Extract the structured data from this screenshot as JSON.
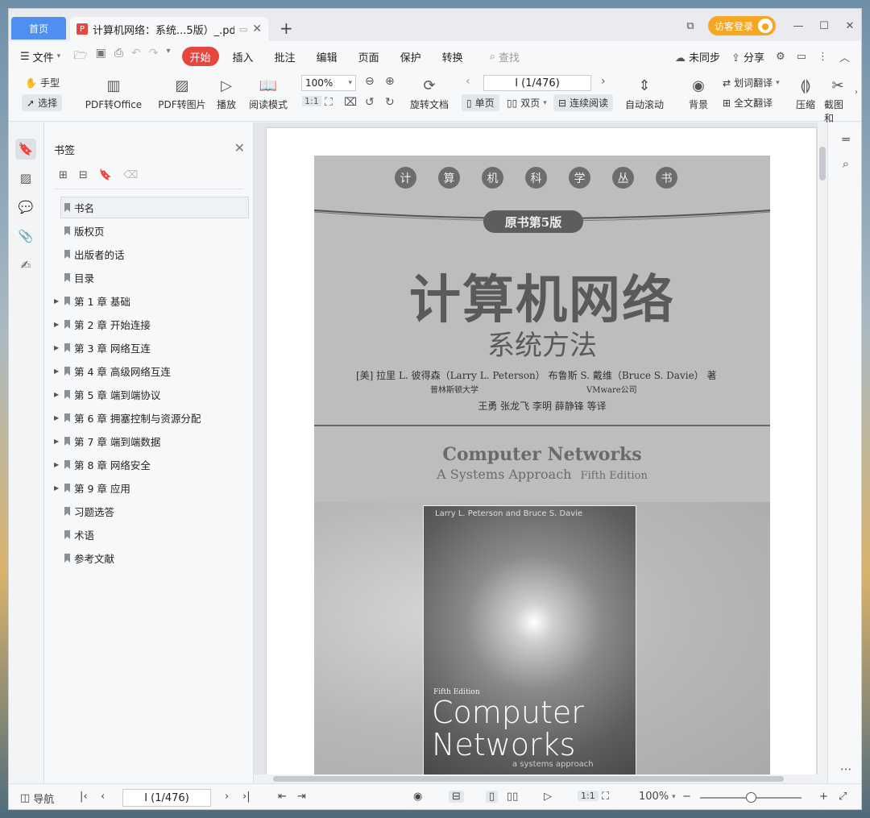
{
  "titlebar": {
    "home_tab": "首页",
    "doc_tab_title": "计算机网络：系统...5版）_.pdf",
    "pdf_badge": "P",
    "add_tab": "+",
    "login_button": "访客登录",
    "minimize": "—",
    "maximize": "☐",
    "close": "✕"
  },
  "menubar": {
    "file": "文件",
    "tabs": [
      "开始",
      "插入",
      "批注",
      "编辑",
      "页面",
      "保护",
      "转换"
    ],
    "search": "查找",
    "sync": "未同步",
    "share": "分享"
  },
  "ribbon": {
    "hand": "手型",
    "select": "选择",
    "pdf_to_office": "PDF转Office",
    "pdf_to_image": "PDF转图片",
    "play": "播放",
    "read_mode": "阅读模式",
    "zoom": "100%",
    "rotate": "旋转文档",
    "page_indicator": "I (1/476)",
    "single_page": "单页",
    "double_page": "双页",
    "continuous": "连续阅读",
    "auto_scroll": "自动滚动",
    "background": "背景",
    "word_translate": "划词翻译",
    "full_translate": "全文翻译",
    "compress": "压缩",
    "screenshot": "截图和"
  },
  "bookmarks": {
    "title": "书签",
    "items": [
      {
        "label": "书名",
        "expandable": false
      },
      {
        "label": "版权页",
        "expandable": false
      },
      {
        "label": "出版者的话",
        "expandable": false
      },
      {
        "label": "目录",
        "expandable": false
      },
      {
        "label": "第 1 章  基础",
        "expandable": true
      },
      {
        "label": "第 2 章  开始连接",
        "expandable": true
      },
      {
        "label": "第 3 章  网络互连",
        "expandable": true
      },
      {
        "label": "第 4 章  高级网络互连",
        "expandable": true
      },
      {
        "label": "第 5 章  端到端协议",
        "expandable": true
      },
      {
        "label": "第 6 章  拥塞控制与资源分配",
        "expandable": true
      },
      {
        "label": "第 7 章  端到端数据",
        "expandable": true
      },
      {
        "label": "第 8 章  网络安全",
        "expandable": true
      },
      {
        "label": "第 9 章  应用",
        "expandable": true
      },
      {
        "label": "习题选答",
        "expandable": false
      },
      {
        "label": "术语",
        "expandable": false
      },
      {
        "label": "参考文献",
        "expandable": false
      }
    ]
  },
  "cover": {
    "series_chars": [
      "计",
      "算",
      "机",
      "科",
      "学",
      "丛",
      "书"
    ],
    "edition": "原书第5版",
    "title_cn": "计算机网络",
    "subtitle_cn": "系统方法",
    "authors": "[美]  拉里  L. 彼得森（Larry L. Peterson） 布鲁斯  S. 戴维（Bruce S. Davie） 著",
    "aff_1": "普林斯顿大学",
    "aff_2": "VMware公司",
    "translators": "王勇  张龙飞  李明  薛静锋  等译",
    "title_en": "Computer Networks",
    "subtitle_en": "A Systems Approach",
    "edition_en": "Fifth Edition",
    "book_authors": "Larry L. Peterson and Bruce S. Davie",
    "book_edition": "Fifth Edition",
    "book_title_1": "Computer",
    "book_title_2": "Networks",
    "book_subtitle": "a systems approach"
  },
  "statusbar": {
    "nav": "导航",
    "page_indicator": "I (1/476)",
    "zoom": "100%",
    "zoom_level": 0.5
  }
}
